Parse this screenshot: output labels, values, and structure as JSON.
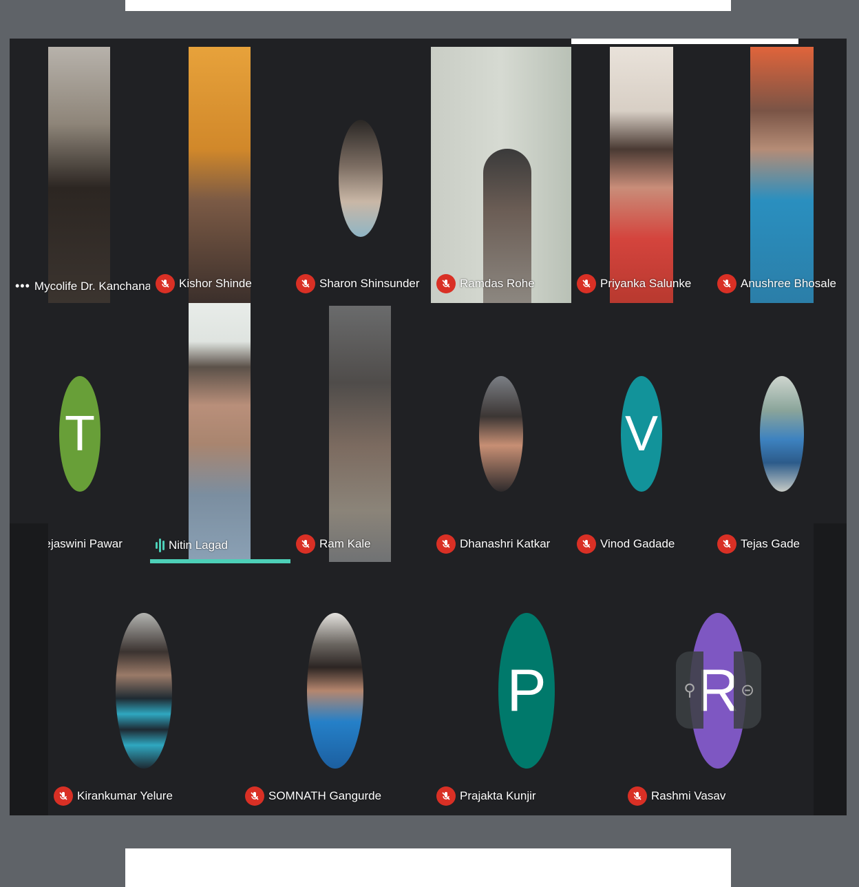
{
  "participants_row1": [
    {
      "name": "Mycolife Dr. Kanchanadi..",
      "muted": false,
      "has_menu": true
    },
    {
      "name": "Kishor Shinde",
      "muted": true
    },
    {
      "name": "Sharon Shinsunder",
      "muted": true
    },
    {
      "name": "Ramdas Rohe",
      "muted": true
    },
    {
      "name": "Priyanka Salunke",
      "muted": true
    },
    {
      "name": "Anushree Bhosale",
      "muted": true
    }
  ],
  "participants_row2": [
    {
      "name": "Tejaswini Pawar",
      "muted": true,
      "initial": "T",
      "color": "#689f38"
    },
    {
      "name": "Nitin Lagad",
      "muted": false,
      "speaking": true
    },
    {
      "name": "Ram Kale",
      "muted": true
    },
    {
      "name": "Dhanashri Katkar",
      "muted": true
    },
    {
      "name": "Vinod Gadade",
      "muted": true,
      "initial": "V",
      "color": "#12939a"
    },
    {
      "name": "Tejas Gade",
      "muted": true
    }
  ],
  "participants_row3": [
    {
      "name": "Kirankumar Yelure",
      "muted": true
    },
    {
      "name": "SOMNATH Gangurde",
      "muted": true
    },
    {
      "name": "Prajakta Kunjir",
      "muted": true,
      "initial": "P",
      "color": "#00796b"
    },
    {
      "name": "Rashmi Vasav",
      "muted": true,
      "initial": "R",
      "color": "#7e57c2"
    }
  ],
  "colors": {
    "mic_muted": "#d93025",
    "speaking": "#4dd0b8",
    "grid_bg": "#202124"
  },
  "icons": {
    "mic_off": "mic-off-icon",
    "menu": "more-icon",
    "pin": "pin-icon",
    "expand": "expand-icon",
    "audio_wave": "audio-wave-icon"
  }
}
